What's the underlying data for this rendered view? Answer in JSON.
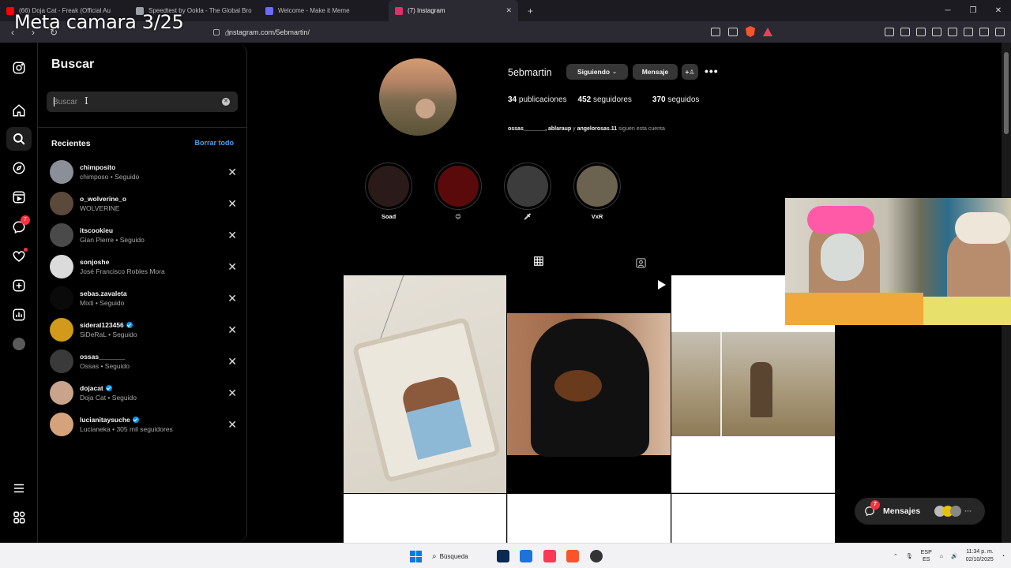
{
  "overlay": {
    "title": "Meta camara 3/25"
  },
  "browser": {
    "tabs": [
      {
        "title": "(66) Doja Cat - Freak (Official Au",
        "fav": "#ff0000",
        "active": false
      },
      {
        "title": "Speedtest by Ookla - The Global Bro",
        "fav": "#9aa0a6",
        "active": false
      },
      {
        "title": "Welcome - Make it Meme",
        "fav": "#6b6bff",
        "active": false
      },
      {
        "title": "(7) Instagram",
        "fav": "#e1306c",
        "active": true
      }
    ],
    "url": "instagram.com/5ebmartin/"
  },
  "search": {
    "title": "Buscar",
    "placeholder": "Buscar",
    "recent_label": "Recientes",
    "clear_all": "Borrar todo",
    "items": [
      {
        "user": "chimposito",
        "sub": "chimposo • Seguido",
        "verified": false,
        "color": "#8a8f99"
      },
      {
        "user": "o_wolverine_o",
        "sub": "WOLVERINE",
        "verified": false,
        "color": "#5b4a3c"
      },
      {
        "user": "itscookieu",
        "sub": "Gian Pierre • Seguido",
        "verified": false,
        "color": "#4a4a4a"
      },
      {
        "user": "sonjoshe",
        "sub": "José Francisco Robles Mora",
        "verified": false,
        "color": "#dbdbdb"
      },
      {
        "user": "sebas.zavaleta",
        "sub": "Mixti • Seguido",
        "verified": false,
        "color": "#0a0a0a"
      },
      {
        "user": "sideral123456",
        "sub": "SiDeRaL • Seguido",
        "verified": true,
        "color": "#d19a1a"
      },
      {
        "user": "ossas_______",
        "sub": "Ossas • Seguido",
        "verified": false,
        "color": "#3a3a3a"
      },
      {
        "user": "dojacat",
        "sub": "Doja Cat • Seguido",
        "verified": true,
        "color": "#c9a38c"
      },
      {
        "user": "lucianitaysuche",
        "sub": "Lucianeka • 305 mil seguidores",
        "verified": true,
        "color": "#d4a37c"
      }
    ]
  },
  "profile": {
    "username": "5ebmartin",
    "following_btn": "Siguiendo",
    "message_btn": "Mensaje",
    "posts_count": "34",
    "posts_label": "publicaciones",
    "followers_count": "452",
    "followers_label": "seguidores",
    "following_count": "370",
    "following_label": "seguidos",
    "followed_by_users": "ossas_______, ablaraup",
    "followed_by_and": "y",
    "followed_by_last": "angelorosas.11",
    "followed_by_suffix": "siguen esta cuenta",
    "highlights": [
      {
        "label": "Soad",
        "color": "#2a1a1a"
      },
      {
        "label": "😉",
        "color": "#5a0a0a"
      },
      {
        "label": "🗡",
        "color": "#3c3c3c"
      },
      {
        "label": "VxR",
        "color": "#6b6250"
      }
    ]
  },
  "messages": {
    "label": "Mensajes",
    "badge": "7"
  },
  "rail": {
    "notif_badge": "7"
  },
  "taskbar": {
    "search_label": "Búsqueda",
    "lang_top": "ESP",
    "lang_bottom": "ES",
    "time": "11:34 p. m.",
    "date": "02/10/2025"
  }
}
